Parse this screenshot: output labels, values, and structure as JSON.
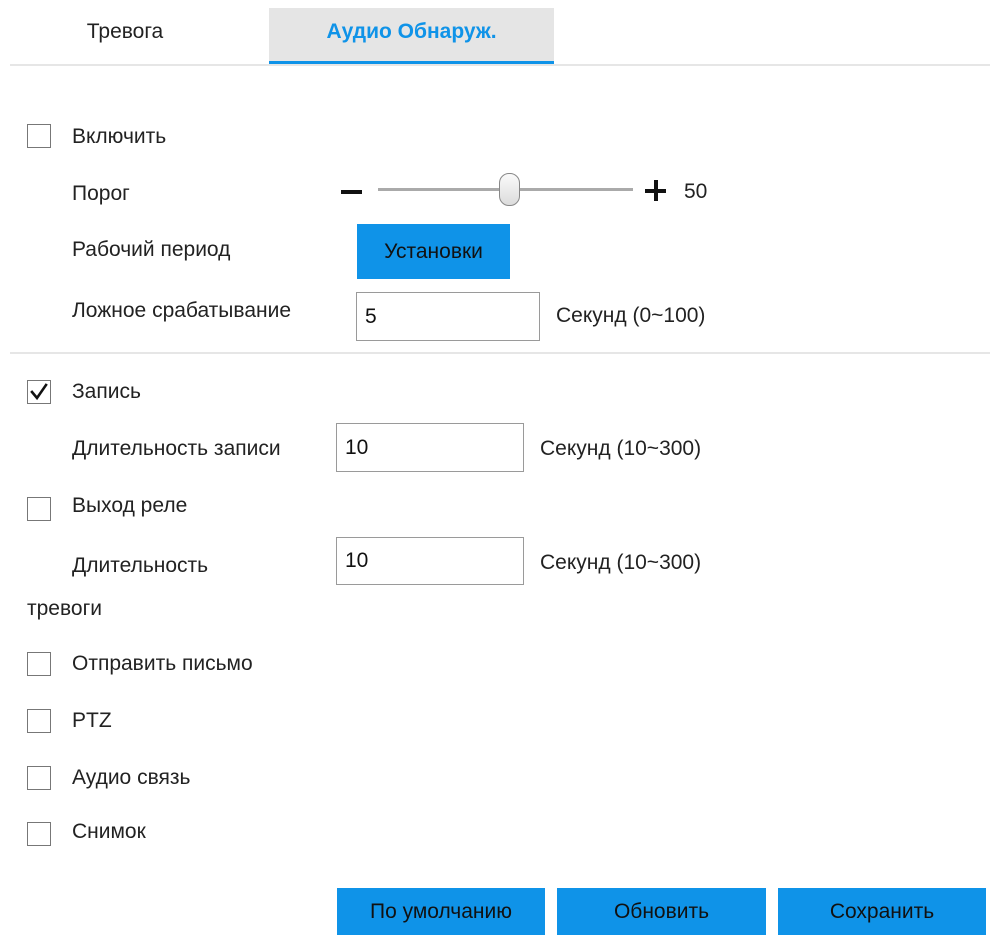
{
  "tabs": {
    "alarm": "Тревога",
    "audio_detection": "Аудио Обнаруж."
  },
  "enable": {
    "label": "Включить",
    "checked": false
  },
  "threshold": {
    "label": "Порог",
    "value": "50",
    "level_percent": 50
  },
  "work_period": {
    "label": "Рабочий период",
    "button": "Установки"
  },
  "false_trigger": {
    "label": "Ложное срабатывание",
    "value": "5",
    "unit": "Секунд (0~100)"
  },
  "record": {
    "label": "Запись",
    "checked": true
  },
  "record_duration": {
    "label": "Длительность записи",
    "value": "10",
    "unit": "Секунд (10~300)"
  },
  "relay_output": {
    "label": "Выход реле",
    "checked": false
  },
  "alarm_duration": {
    "label_line1": "Длительность",
    "label_line2": "тревоги",
    "value": "10",
    "unit": "Секунд (10~300)"
  },
  "send_email": {
    "label": "Отправить письмо",
    "checked": false
  },
  "ptz": {
    "label": "PTZ",
    "checked": false
  },
  "audio_talk": {
    "label": "Аудио связь",
    "checked": false
  },
  "snapshot": {
    "label": "Снимок",
    "checked": false
  },
  "actions": {
    "default": "По умолчанию",
    "refresh": "Обновить",
    "save": "Сохранить"
  },
  "colors": {
    "accent": "#0f93e8",
    "tab_bg": "#e5e5e5"
  }
}
